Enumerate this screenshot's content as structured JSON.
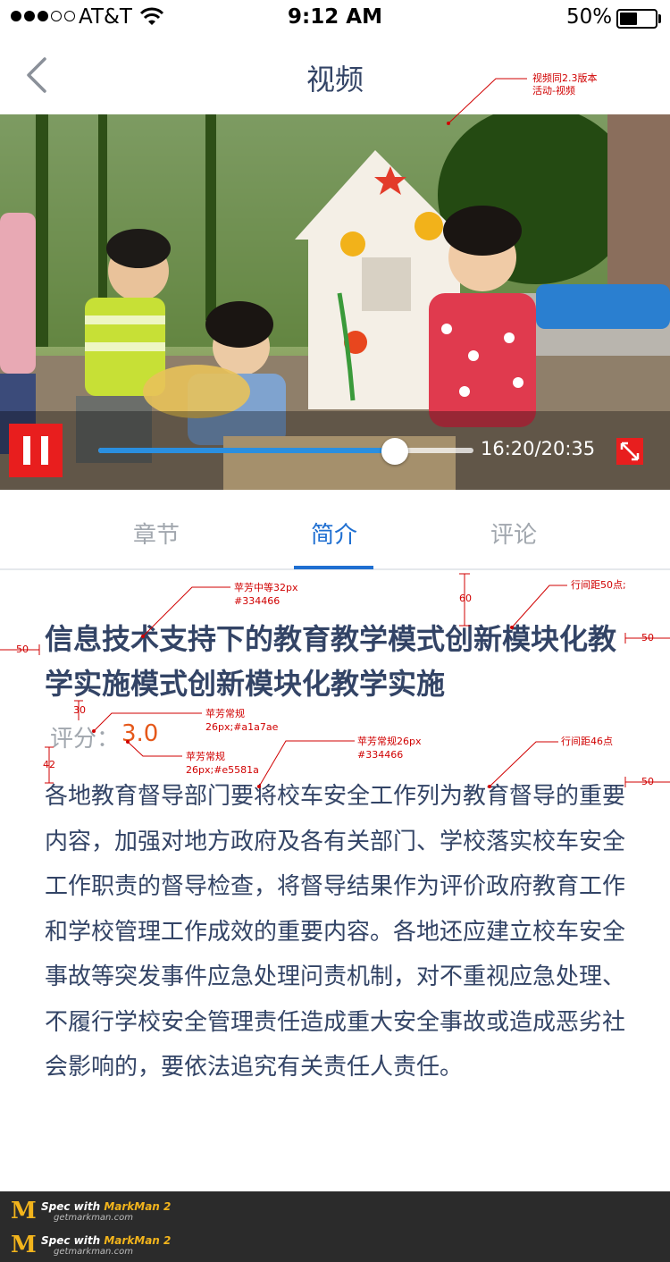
{
  "status_bar": {
    "carrier": "AT&T",
    "time": "9:12 AM",
    "battery_percent": "50%",
    "battery_level": 0.5,
    "signal_bars": 3
  },
  "nav": {
    "title": "视频",
    "back_icon": "chevron-left-icon"
  },
  "video": {
    "time_display": "16:20/20:35",
    "progress": 0.79,
    "play_icon": "pause-icon",
    "fullscreen_icon": "expand-icon"
  },
  "tabs": [
    {
      "label": "章节",
      "active": false
    },
    {
      "label": "简介",
      "active": true
    },
    {
      "label": "评论",
      "active": false
    }
  ],
  "content": {
    "title": "信息技术支持下的教育教学模式创新模块化教学实施模式创新模块化教学实施",
    "rating_label": "评分：",
    "rating_value": "3.0",
    "description": "各地教育督导部门要将校车安全工作列为教育督导的重要内容，加强对地方政府及各有关部门、学校落实校车安全工作职责的督导检查，将督导结果作为评价政府教育工作和学校管理工作成效的重要内容。各地还应建立校车安全事故等突发事件应急处理问责机制，对不重视应急处理、不履行学校安全管理责任造成重大安全事故或造成恶劣社会影响的，要依法追究有关责任人责任。"
  },
  "annotations": {
    "video_note_1": "视频同2.3版本",
    "video_note_2": "活动-视频",
    "title_font": "苹芳中等32px",
    "title_color": "#334466",
    "title_line_height": "行间距50点;",
    "spacing_60": "60",
    "margin_left_1": "50",
    "margin_right_1": "50",
    "spacing_30": "30",
    "rating_label_font": "苹芳常规",
    "rating_label_spec": "26px;#a1a7ae",
    "rating_value_font": "苹芳常规",
    "rating_value_spec": "26px;#e5581a",
    "spacing_42": "42",
    "desc_font": "苹芳常规26px",
    "desc_color": "#334466",
    "desc_line_height": "行间距46点",
    "margin_right_2": "50"
  },
  "footer": {
    "brand_prefix": "Spec with ",
    "brand_name": "MarkMan 2",
    "site": "getmarkman.com"
  },
  "colors": {
    "primary_text": "#334466",
    "secondary_text": "#a1a7ae",
    "accent_orange": "#e5581a",
    "accent_blue": "#1f6fd1",
    "control_red": "#e81e1e"
  }
}
